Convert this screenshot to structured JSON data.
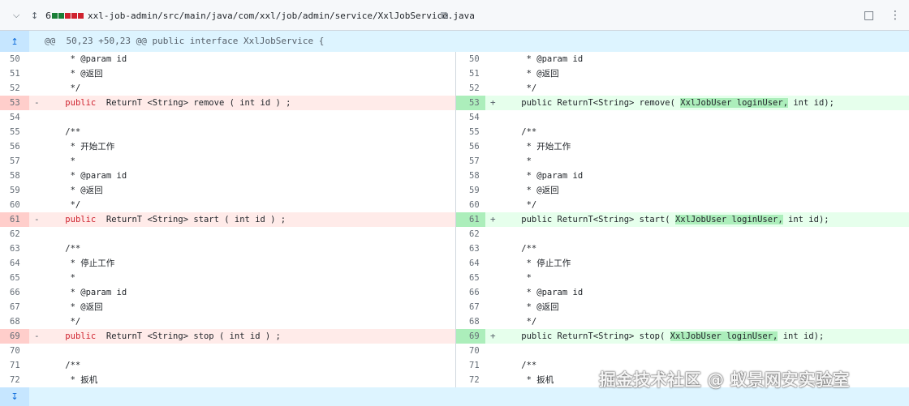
{
  "header": {
    "changed_count": "6",
    "file_path": "xxl-job-admin/src/main/java/com/xxl/job/admin/service/XxlJobService.java",
    "icons": [
      "chevron-down-icon",
      "unfold-icon",
      "copy-icon",
      "comment-icon",
      "kebab-icon"
    ]
  },
  "hunk": {
    "text": "@@  50,23 +50,23 @@ public interface XxlJobService {"
  },
  "rows": [
    {
      "l_num": "50",
      "l_code": "     * @param id",
      "r_num": "50",
      "r_code": "     * @param id",
      "type": "ctx"
    },
    {
      "l_num": "51",
      "l_code": "     * @返回",
      "r_num": "51",
      "r_code": "     * @返回",
      "type": "ctx"
    },
    {
      "l_num": "52",
      "l_code": "     */",
      "r_num": "52",
      "r_code": "     */",
      "type": "ctx"
    },
    {
      "l_num": "53",
      "l_code": "    public  ReturnT <String> remove ( int id ) ;",
      "r_num": "53",
      "r_code": "    public ReturnT<String> remove( XxlJobUser loginUser, int id);",
      "type": "chg",
      "method": "remove"
    },
    {
      "l_num": "54",
      "l_code": "",
      "r_num": "54",
      "r_code": "",
      "type": "ctx"
    },
    {
      "l_num": "55",
      "l_code": "    /**",
      "r_num": "55",
      "r_code": "    /**",
      "type": "ctx"
    },
    {
      "l_num": "56",
      "l_code": "     * 开始工作",
      "r_num": "56",
      "r_code": "     * 开始工作",
      "type": "ctx"
    },
    {
      "l_num": "57",
      "l_code": "     *",
      "r_num": "57",
      "r_code": "     *",
      "type": "ctx"
    },
    {
      "l_num": "58",
      "l_code": "     * @param id",
      "r_num": "58",
      "r_code": "     * @param id",
      "type": "ctx"
    },
    {
      "l_num": "59",
      "l_code": "     * @返回",
      "r_num": "59",
      "r_code": "     * @返回",
      "type": "ctx"
    },
    {
      "l_num": "60",
      "l_code": "     */",
      "r_num": "60",
      "r_code": "     */",
      "type": "ctx"
    },
    {
      "l_num": "61",
      "l_code": "    public  ReturnT <String> start ( int id ) ;",
      "r_num": "61",
      "r_code": "    public ReturnT<String> start( XxlJobUser loginUser, int id);",
      "type": "chg",
      "method": "start"
    },
    {
      "l_num": "62",
      "l_code": "",
      "r_num": "62",
      "r_code": "",
      "type": "ctx"
    },
    {
      "l_num": "63",
      "l_code": "    /**",
      "r_num": "63",
      "r_code": "    /**",
      "type": "ctx"
    },
    {
      "l_num": "64",
      "l_code": "     * 停止工作",
      "r_num": "64",
      "r_code": "     * 停止工作",
      "type": "ctx"
    },
    {
      "l_num": "65",
      "l_code": "     *",
      "r_num": "65",
      "r_code": "     *",
      "type": "ctx"
    },
    {
      "l_num": "66",
      "l_code": "     * @param id",
      "r_num": "66",
      "r_code": "     * @param id",
      "type": "ctx"
    },
    {
      "l_num": "67",
      "l_code": "     * @返回",
      "r_num": "67",
      "r_code": "     * @返回",
      "type": "ctx"
    },
    {
      "l_num": "68",
      "l_code": "     */",
      "r_num": "68",
      "r_code": "     */",
      "type": "ctx"
    },
    {
      "l_num": "69",
      "l_code": "    public  ReturnT <String> stop ( int id ) ;",
      "r_num": "69",
      "r_code": "    public ReturnT<String> stop( XxlJobUser loginUser, int id);",
      "type": "chg",
      "method": "stop"
    },
    {
      "l_num": "70",
      "l_code": "",
      "r_num": "70",
      "r_code": "",
      "type": "ctx"
    },
    {
      "l_num": "71",
      "l_code": "    /**",
      "r_num": "71",
      "r_code": "    /**",
      "type": "ctx"
    },
    {
      "l_num": "72",
      "l_code": "     * 扳机",
      "r_num": "72",
      "r_code": "     * 扳机",
      "type": "ctx"
    }
  ],
  "markers": {
    "del": "-",
    "add": "+"
  },
  "highlight_text": "XxlJobUser loginUser,",
  "watermark": "掘金技术社区 @ 蚁景网安实验室",
  "colors": {
    "deletion_bg": "#ffebe9",
    "deletion_num_bg": "#ffcecb",
    "addition_bg": "#e6ffec",
    "addition_num_bg": "#aceebb",
    "hunk_bg": "#ddf4ff"
  }
}
